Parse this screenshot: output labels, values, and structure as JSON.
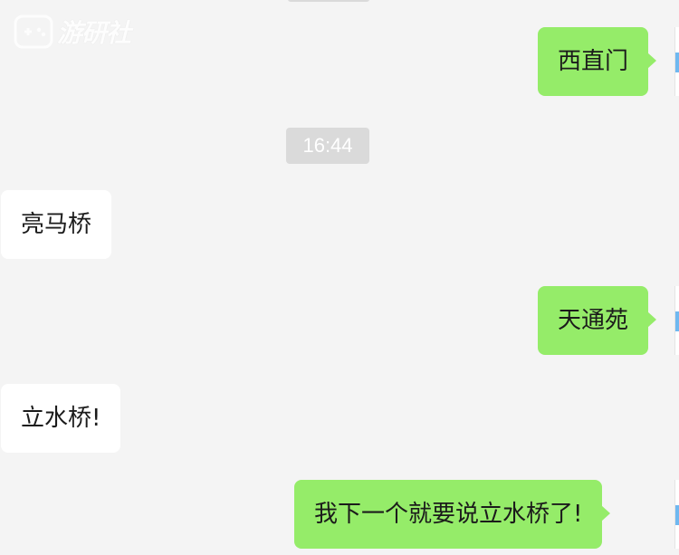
{
  "watermark": {
    "logo": "gamepad-logo-icon",
    "text": "游研社"
  },
  "timestamp": "16:44",
  "messages": [
    {
      "sender": "me",
      "text": "西直门"
    },
    {
      "sender": "them",
      "text": "亮马桥"
    },
    {
      "sender": "me",
      "text": "天通苑"
    },
    {
      "sender": "them",
      "text": "立水桥!"
    },
    {
      "sender": "me",
      "text": "我下一个就要说立水桥了!"
    }
  ],
  "colors": {
    "background": "#f4f4f4",
    "outgoing_bubble": "#95ec69",
    "incoming_bubble": "#ffffff",
    "timestamp_bg": "#dadada"
  }
}
